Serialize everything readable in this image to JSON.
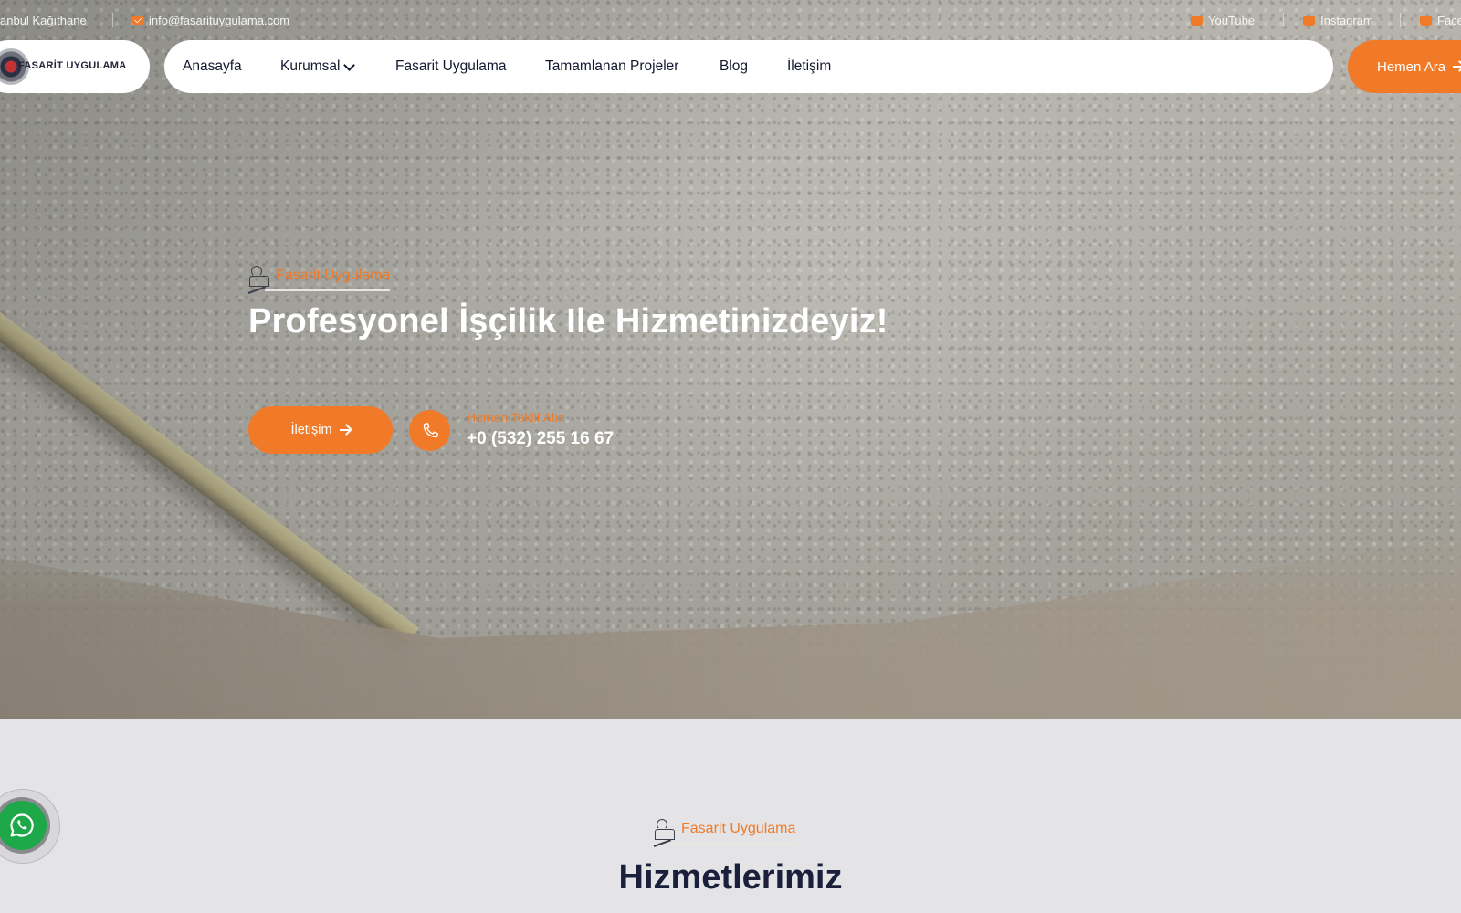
{
  "topbar": {
    "location": "anbul Kağıthane",
    "email": "info@fasarituygulama.com",
    "social": [
      "YouTube",
      "Instagram",
      "Face"
    ]
  },
  "header": {
    "logo_text": "FASARİT UYGULAMA",
    "nav": [
      "Anasayfa",
      "Kurumsal",
      "Fasarit Uygulama",
      "Tamamlanan Projeler",
      "Blog",
      "İletişim"
    ],
    "cta": "Hemen Ara"
  },
  "hero": {
    "eyebrow": "Fasarit Uygulama",
    "title": "Profesyonel İşçilik Ile Hizmetinizdeyiz!",
    "contact_button": "İletişim",
    "quote_label": "Hemen Teklif Alın",
    "phone": "+0 (532) 255 16 67"
  },
  "services": {
    "eyebrow": "Fasarit Uygulama",
    "title": "Hizmetlerimiz"
  },
  "colors": {
    "accent": "#f07a28",
    "navy": "#1a1f3b",
    "whatsapp": "#1ea84a"
  },
  "icons": [
    "mail-icon",
    "youtube-icon",
    "instagram-icon",
    "facebook-icon",
    "chevron-down-icon",
    "arrow-right-icon",
    "worker-icon",
    "phone-icon",
    "whatsapp-icon"
  ]
}
